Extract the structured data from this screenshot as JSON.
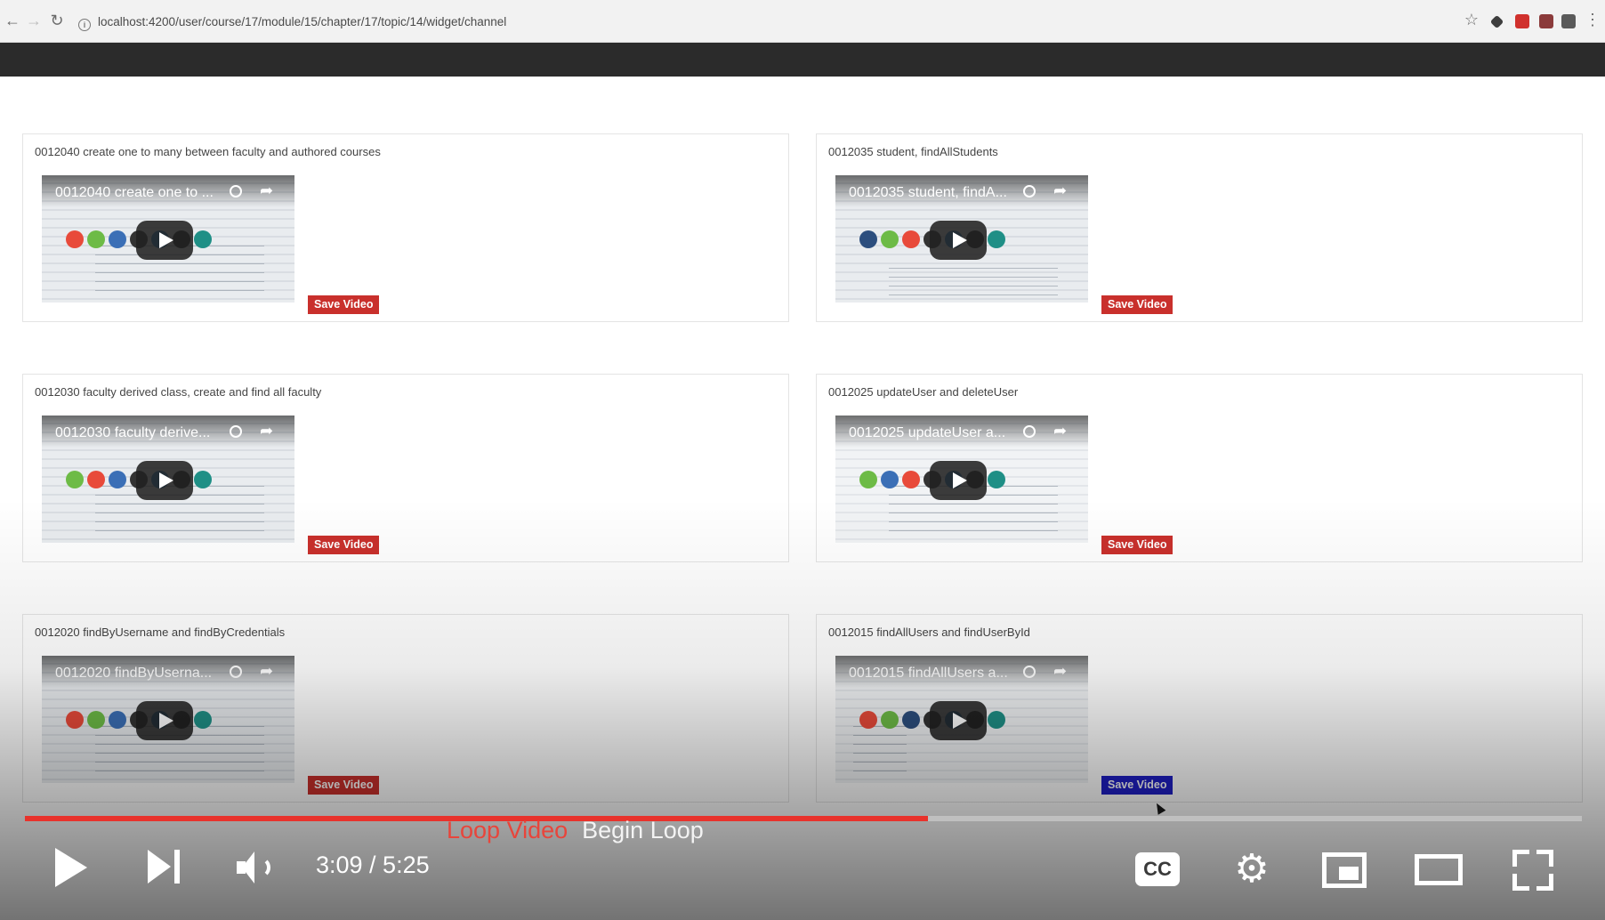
{
  "browser": {
    "url": "localhost:4200/user/course/17/module/15/chapter/17/topic/14/widget/channel",
    "icons": [
      "back-arrow-icon",
      "forward-arrow-icon",
      "reload-icon",
      "info-icon",
      "star-icon",
      "extension-icons",
      "menu-kebab-icon"
    ]
  },
  "save_label": "Save Video",
  "cards": [
    {
      "title": "0012040 create one to many between faculty and authored courses",
      "video_title": "0012040 create one to ...",
      "save_highlighted": false
    },
    {
      "title": "0012035 student, findAllStudents",
      "video_title": "0012035 student, findA...",
      "save_highlighted": false
    },
    {
      "title": "0012030 faculty derived class, create and find all faculty",
      "video_title": "0012030 faculty derive...",
      "save_highlighted": false
    },
    {
      "title": "0012025 updateUser and deleteUser",
      "video_title": "0012025 updateUser a...",
      "save_highlighted": false
    },
    {
      "title": "0012020 findByUsername and findByCredentials",
      "video_title": "0012020 findByUserna...",
      "save_highlighted": false
    },
    {
      "title": "0012015 findAllUsers and findUserById",
      "video_title": "0012015 findAllUsers a...",
      "save_highlighted": true
    }
  ],
  "player": {
    "progress": 0.58,
    "loop_video_label": "Loop Video",
    "begin_loop_label": "Begin Loop",
    "time": "3:09 / 5:25",
    "cc_label": "CC",
    "gear_glyph": "⚙"
  },
  "colors": {
    "save": "#c9302c",
    "save_active": "#1f1fc6",
    "progress": "#e8322b",
    "header": "#2b2b2b"
  }
}
